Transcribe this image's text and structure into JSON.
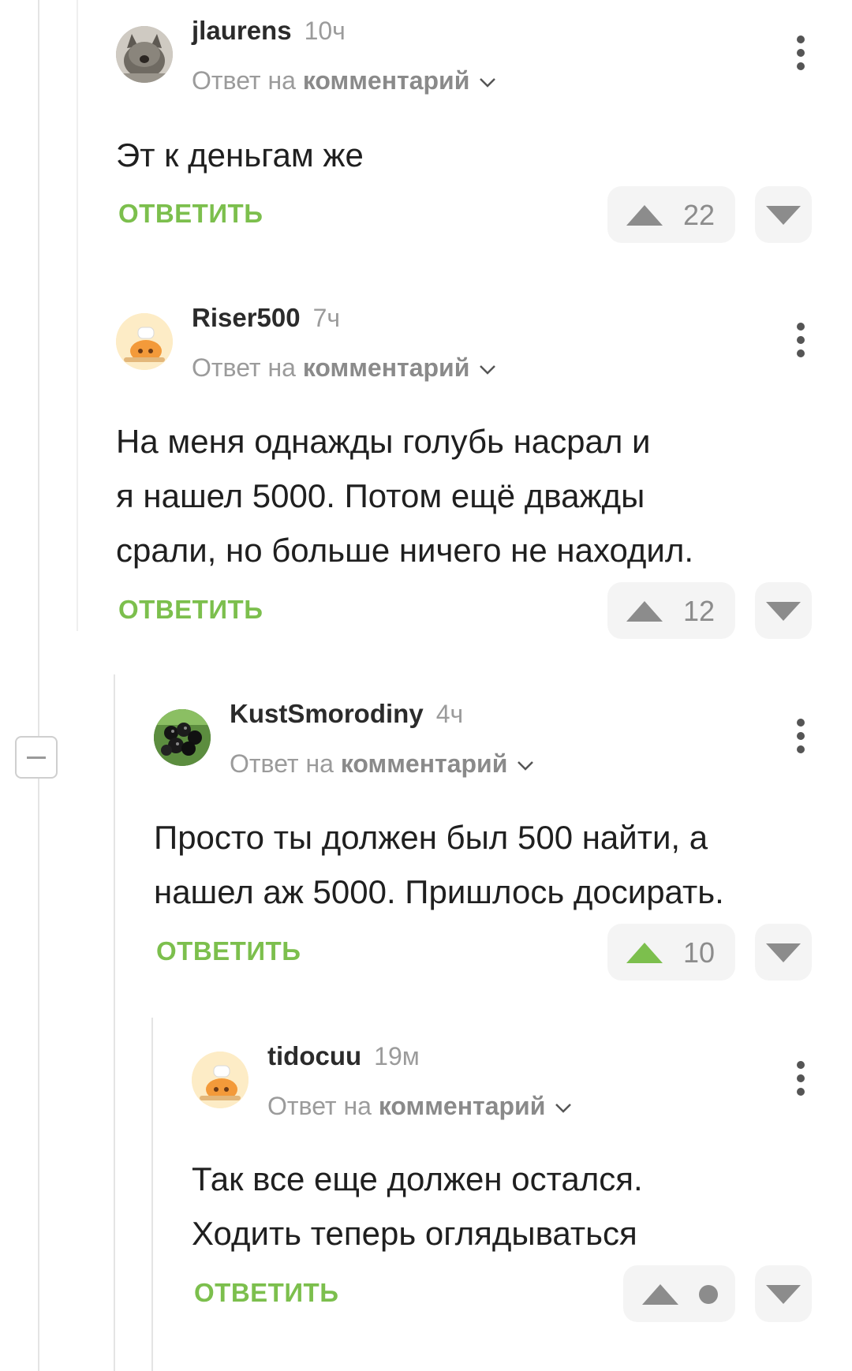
{
  "comments": [
    {
      "username": "jlaurens",
      "time": "10ч",
      "reply_prefix": "Ответ на",
      "reply_target": "комментарий",
      "text_lines": [
        "Эт к деньгам же"
      ],
      "reply_label": "ОТВЕТИТЬ",
      "votes": "22",
      "upvoted": false,
      "avatar": "cat-avatar"
    },
    {
      "username": "Riser500",
      "time": "7ч",
      "reply_prefix": "Ответ на",
      "reply_target": "комментарий",
      "text_lines": [
        "На меня однажды голубь насрал и",
        "я нашел 5000. Потом ещё дважды",
        "срали, но больше ничего не находил."
      ],
      "reply_label": "ОТВЕТИТЬ",
      "votes": "12",
      "upvoted": false,
      "avatar": "chef-avatar"
    },
    {
      "username": "KustSmorodiny",
      "time": "4ч",
      "reply_prefix": "Ответ на",
      "reply_target": "комментарий",
      "text_lines": [
        "Просто ты должен был 500 найти, а",
        "нашел аж 5000. Пришлось досирать."
      ],
      "reply_label": "ОТВЕТИТЬ",
      "votes": "10",
      "upvoted": true,
      "avatar": "currant-avatar"
    },
    {
      "username": "tidocuu",
      "time": "19м",
      "reply_prefix": "Ответ на",
      "reply_target": "комментарий",
      "text_lines": [
        "Так все еще должен остался.",
        "Ходить теперь оглядываться"
      ],
      "reply_label": "ОТВЕТИТЬ",
      "votes": "",
      "upvoted": false,
      "avatar": "chef-avatar"
    }
  ],
  "colors": {
    "accent_green": "#7cbf4d",
    "muted_gray": "#9b9b9b",
    "vote_bg": "#f4f4f4"
  }
}
